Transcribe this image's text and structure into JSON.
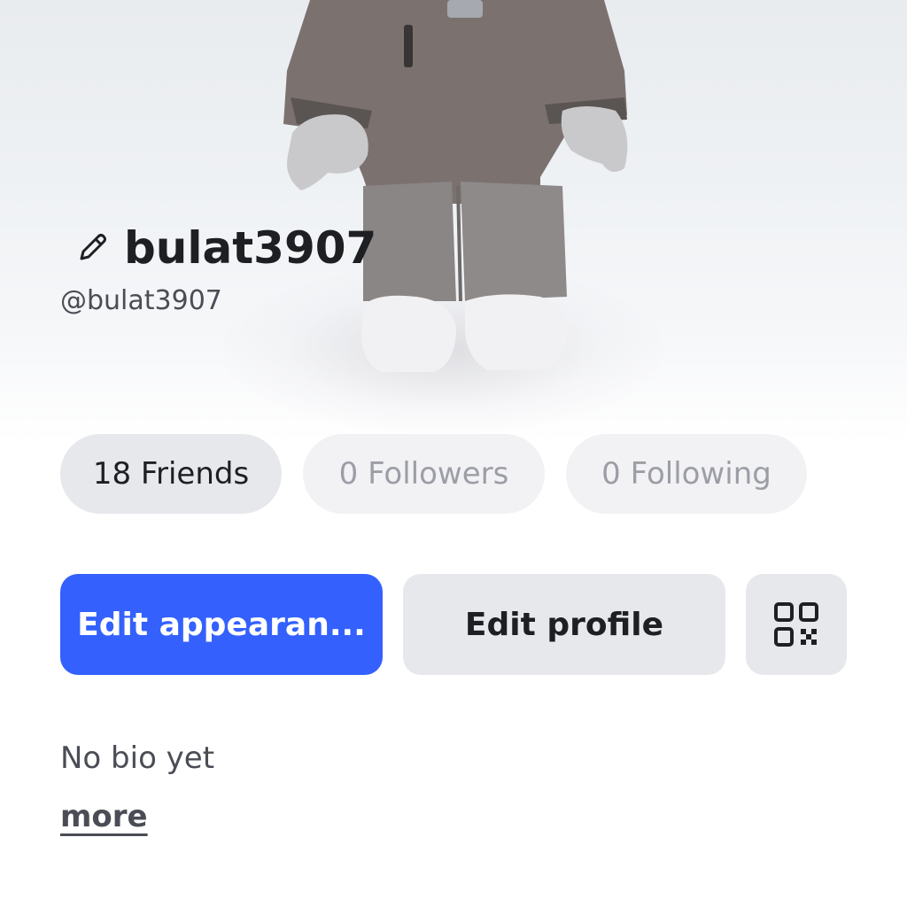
{
  "profile": {
    "display_name": "bulat3907",
    "username": "@bulat3907",
    "bio": "No bio yet",
    "more_label": "more"
  },
  "stats": {
    "friends": "18 Friends",
    "followers": "0 Followers",
    "following": "0 Following"
  },
  "actions": {
    "edit_appearance": "Edit appearan...",
    "edit_profile": "Edit profile",
    "qr_icon": "qr-code-icon"
  },
  "icons": {
    "edit_name": "pencil-icon"
  },
  "colors": {
    "primary": "#3461fd",
    "chip_bg": "#e7e8ec",
    "chip_dim_bg": "#f2f2f5",
    "text_dark": "#1e1f22",
    "text_muted": "#9c9ea6"
  }
}
